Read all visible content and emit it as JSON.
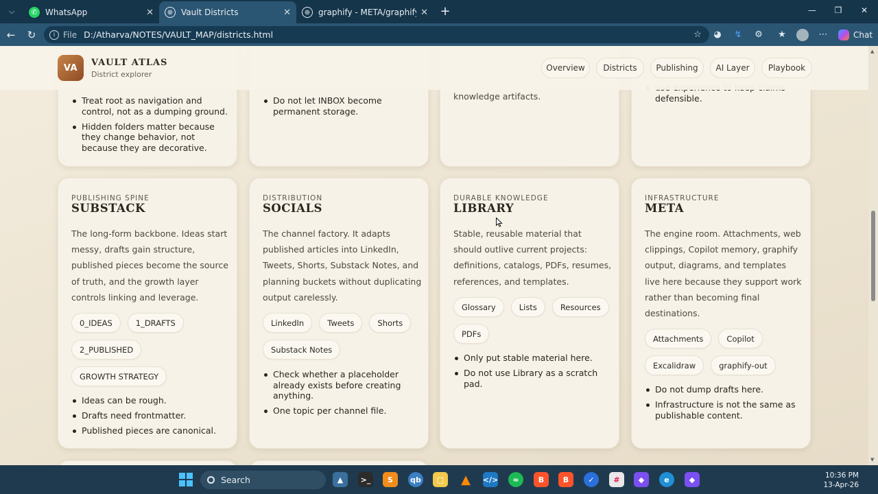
{
  "browser": {
    "tabs": [
      {
        "title": "WhatsApp",
        "icon": "whatsapp-icon"
      },
      {
        "title": "Vault Districts",
        "icon": "globe-icon",
        "active": true
      },
      {
        "title": "graphify - META/graphify-out/gra",
        "icon": "globe-icon"
      }
    ],
    "address": {
      "scheme": "File",
      "url": "D:/Atharva/NOTES/VAULT_MAP/districts.html"
    },
    "chat_label": "Chat"
  },
  "site": {
    "logo_text": "VA",
    "title": "VAULT ATLAS",
    "subtitle": "District explorer",
    "nav": [
      "Overview",
      "Districts",
      "Publishing",
      "AI Layer",
      "Playbook"
    ]
  },
  "top_cards": [
    {
      "rules": [
        "Treat root as navigation and control, not as a dumping ground.",
        "Hidden folders matter because they change behavior, not because they are decorative."
      ]
    },
    {
      "rules": [
        "Do not let INBOX become permanent storage."
      ]
    },
    {
      "text": "knowledge artifacts."
    },
    {
      "text_partial": "use experience to keep claims",
      "text": "defensible."
    }
  ],
  "cards": [
    {
      "eyebrow": "PUBLISHING SPINE",
      "title": "SUBSTACK",
      "description": "The long-form backbone. Ideas start messy, drafts gain structure, published pieces become the source of truth, and the growth layer controls linking and leverage.",
      "chips": [
        "0_IDEAS",
        "1_DRAFTS",
        "2_PUBLISHED",
        "GROWTH STRATEGY"
      ],
      "rules": [
        "Ideas can be rough.",
        "Drafts need frontmatter.",
        "Published pieces are canonical."
      ]
    },
    {
      "eyebrow": "DISTRIBUTION",
      "title": "SOCIALS",
      "description": "The channel factory. It adapts published articles into LinkedIn, Tweets, Shorts, Substack Notes, and planning buckets without duplicating output carelessly.",
      "chips": [
        "LinkedIn",
        "Tweets",
        "Shorts",
        "Substack Notes"
      ],
      "rules": [
        "Check whether a placeholder already exists before creating anything.",
        "One topic per channel file."
      ]
    },
    {
      "eyebrow": "DURABLE KNOWLEDGE",
      "title": "LIBRARY",
      "description": "Stable, reusable material that should outlive current projects: definitions, catalogs, PDFs, resumes, references, and templates.",
      "chips": [
        "Glossary",
        "Lists",
        "Resources",
        "PDFs"
      ],
      "rules": [
        "Only put stable material here.",
        "Do not use Library as a scratch pad."
      ]
    },
    {
      "eyebrow": "INFRASTRUCTURE",
      "title": "META",
      "description": "The engine room. Attachments, web clippings, Copilot memory, graphify output, diagrams, and templates live here because they support work rather than becoming final destinations.",
      "chips": [
        "Attachments",
        "Copilot",
        "Excalidraw",
        "graphify-out"
      ],
      "rules": [
        "Do not dump drafts here.",
        "Infrastructure is not the same as publishable content."
      ]
    }
  ],
  "taskbar": {
    "search_placeholder": "Search",
    "time": "10:36 PM",
    "date": "13-Apr-26"
  },
  "colors": {
    "accent": "#a0602f",
    "page_bg": "#efe7d7",
    "card_bg": "#f7f2e8",
    "chrome": "#2b5673"
  }
}
